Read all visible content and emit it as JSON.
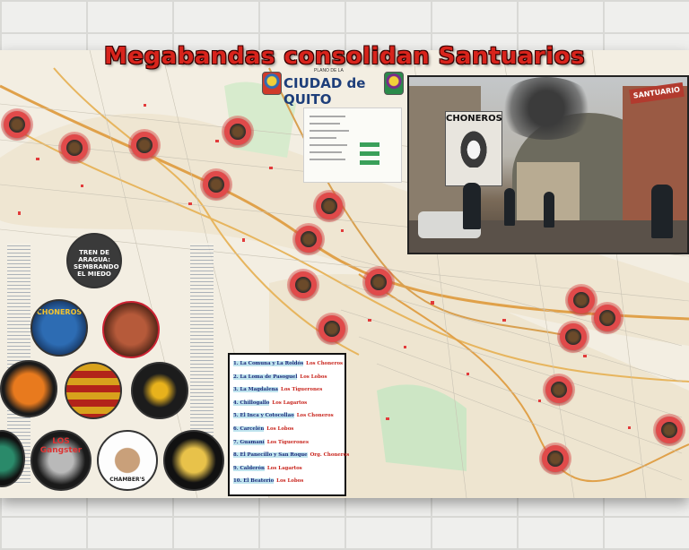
{
  "poster": {
    "title": "Megabandas consolidan Santuarios",
    "map_header": {
      "city_title": "CIUDAD de QUITO",
      "subtitle": "PLANO DE LA"
    }
  },
  "photo": {
    "billboard_text": "CHONEROS",
    "sign_text": "SANTUARIO"
  },
  "gang_list": [
    {
      "place": "1. La Comuna y La Roldós",
      "gang": "Los Choneros"
    },
    {
      "place": "2. La Loma de Pasoguel",
      "gang": "Los Lobos"
    },
    {
      "place": "3. La Magdalena",
      "gang": "Los Tiguerones"
    },
    {
      "place": "4. Chillogallo",
      "gang": "Los Lagartos"
    },
    {
      "place": "5. El Inca y Cotocollao",
      "gang": "Los Choneros"
    },
    {
      "place": "6. Carcelén",
      "gang": "Los Lobos"
    },
    {
      "place": "7. Guamaní",
      "gang": "Los Tiguerones"
    },
    {
      "place": "8. El Panecillo y San Roque",
      "gang": "Org. Choneros"
    },
    {
      "place": "9. Calderón",
      "gang": "Los Lagartos"
    },
    {
      "place": "10. El Beaterio",
      "gang": "Los Lobos"
    }
  ],
  "logos": {
    "tren_de_aragua": "TREN DE ARAGUA: SEMBRANDO EL MIEDO",
    "choneros": "CHONEROS",
    "los_gangster": "LOS Gangster",
    "chambers": "CHAMBER'S"
  },
  "colors": {
    "title_red": "#d8241c",
    "marker_red": "#e04a4a",
    "place_text": "#1c2b7a",
    "gang_text": "#c8241c"
  }
}
